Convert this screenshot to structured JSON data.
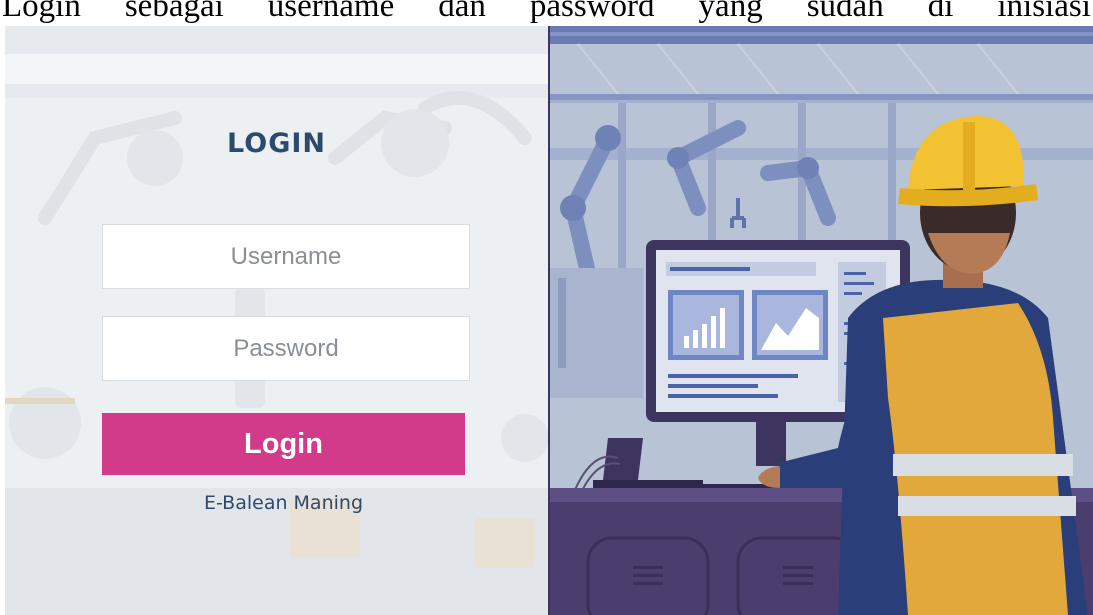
{
  "document_text": [
    "Login",
    "sebagai",
    "username",
    "dan",
    "password",
    "yang",
    "sudah",
    "di",
    "inisiasi"
  ],
  "login_form": {
    "title": "LOGIN",
    "username_placeholder": "Username",
    "password_placeholder": "Password",
    "submit_label": "Login",
    "app_name": "E-Balean Maning"
  },
  "illustration": {
    "icons": [
      "robot-arm-icon",
      "monitor-icon",
      "bar-chart-icon",
      "area-chart-icon",
      "worker-hardhat-icon",
      "laptop-icon",
      "keyboard-icon"
    ]
  },
  "colors": {
    "accent": "#d23b8a",
    "title_text": "#2d4a6e",
    "illustration_bg": "#b9c3d6",
    "helmet": "#f2c232",
    "vest": "#e3a83b",
    "desk": "#4c3d6f"
  }
}
